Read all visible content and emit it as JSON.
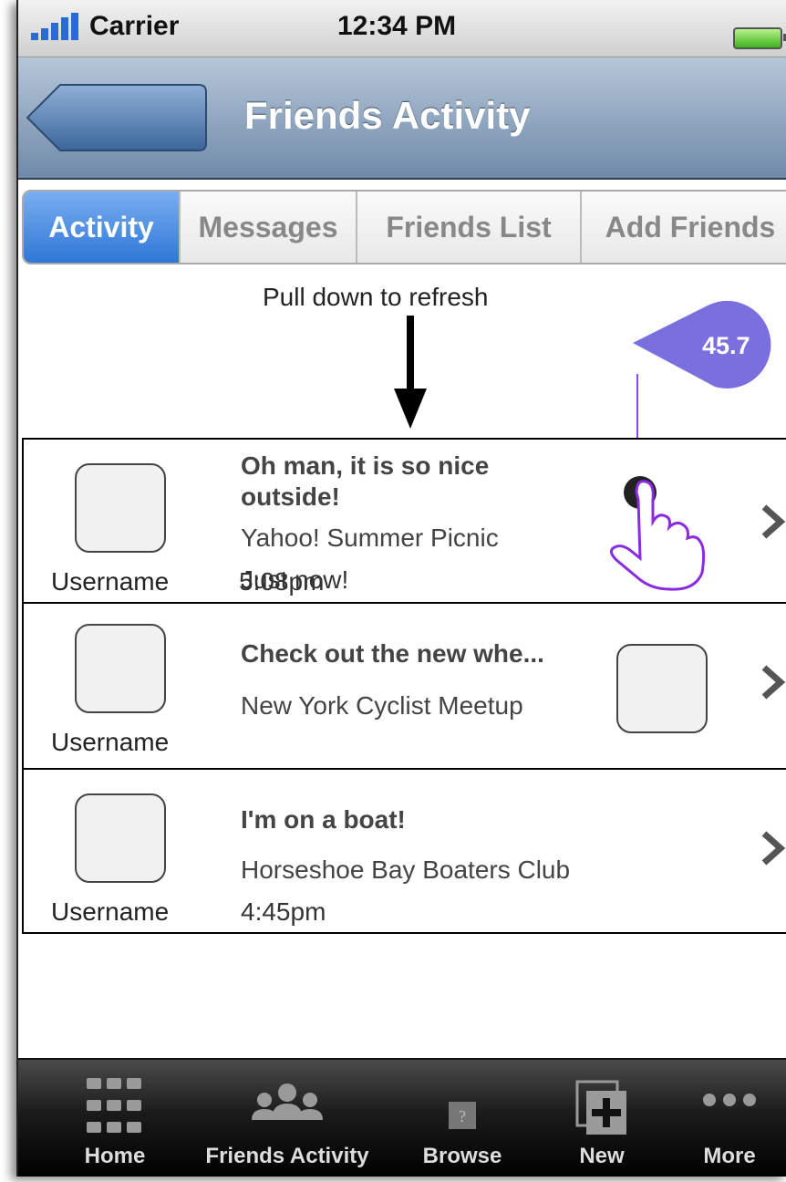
{
  "status_bar": {
    "carrier": "Carrier",
    "time": "12:34 PM"
  },
  "nav": {
    "title": "Friends Activity"
  },
  "segments": [
    {
      "label": "Activity",
      "active": true
    },
    {
      "label": "Messages",
      "active": false
    },
    {
      "label": "Friends List",
      "active": false
    },
    {
      "label": "Add Friends",
      "active": false
    }
  ],
  "pull_hint": "Pull down to refresh",
  "annotation": {
    "value": "45.7",
    "color": "#7b6fe0"
  },
  "feed": [
    {
      "username": "Username",
      "title_line1": "Oh man, it is so nice",
      "title_line2": "outside!",
      "group": "Yahoo! Summer Picnic",
      "time": "Just now!",
      "time_overlap": "5:08pm"
    },
    {
      "username": "Username",
      "title": "Check out the new whe...",
      "group": "New York Cyclist Meetup"
    },
    {
      "username": "Username",
      "title": "I'm on a boat!",
      "group": "Horseshoe Bay Boaters Club",
      "time": "4:45pm"
    }
  ],
  "tabbar": [
    {
      "label": "Home",
      "icon": "grid-icon"
    },
    {
      "label": "Friends Activity",
      "icon": "people-icon"
    },
    {
      "label": "Browse",
      "icon": "question-box-icon"
    },
    {
      "label": "New",
      "icon": "add-document-icon"
    },
    {
      "label": "More",
      "icon": "more-dots-icon"
    }
  ]
}
